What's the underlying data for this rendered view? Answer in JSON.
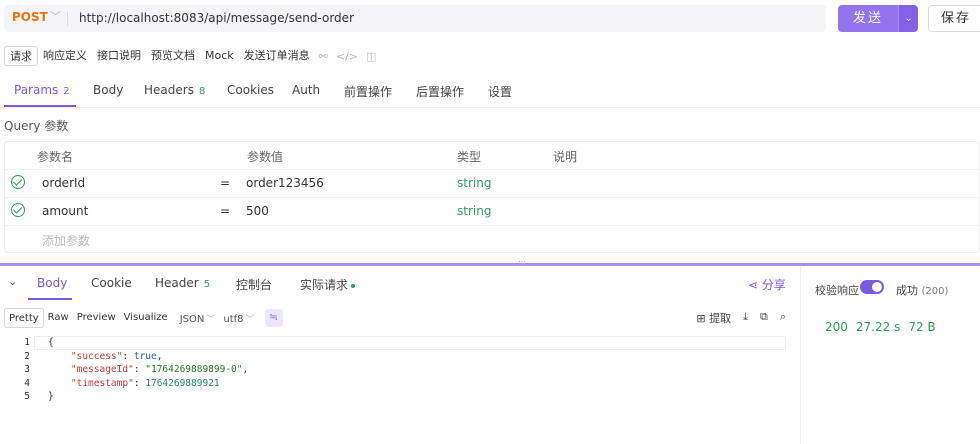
{
  "request": {
    "method": "POST",
    "url": "http://localhost:8083/api/message/send-order",
    "send_label": "发送",
    "save_label": "保存"
  },
  "doc_tabs": [
    "请求",
    "响应定义",
    "接口说明",
    "预览文档",
    "Mock",
    "发送订单消息"
  ],
  "request_tabs": [
    {
      "label": "Params",
      "count": "2"
    },
    {
      "label": "Body",
      "count": ""
    },
    {
      "label": "Headers",
      "count": "8"
    },
    {
      "label": "Cookies",
      "count": ""
    },
    {
      "label": "Auth",
      "count": ""
    },
    {
      "label": "前置操作",
      "count": ""
    },
    {
      "label": "后置操作",
      "count": ""
    },
    {
      "label": "设置",
      "count": ""
    }
  ],
  "query_section_label": "Query 参数",
  "params_table": {
    "headers": [
      "参数名",
      "参数值",
      "类型",
      "说明"
    ],
    "rows": [
      {
        "name": "orderId",
        "eq": "=",
        "value": "order123456",
        "type": "string",
        "desc": ""
      },
      {
        "name": "amount",
        "eq": "=",
        "value": "500",
        "type": "string",
        "desc": ""
      }
    ],
    "add_placeholder": "添加参数"
  },
  "response_tabs": [
    {
      "label": "Body",
      "count": ""
    },
    {
      "label": "Cookie",
      "count": ""
    },
    {
      "label": "Header",
      "count": "5"
    },
    {
      "label": "控制台",
      "count": ""
    },
    {
      "label": "实际请求",
      "count": ""
    }
  ],
  "share_label": "分享",
  "format_buttons": [
    "Pretty",
    "Raw",
    "Preview",
    "Visualize"
  ],
  "format_select": "JSON",
  "encoding_select": "utf8",
  "extract_label": "提取",
  "code_lines": [
    {
      "no": "1",
      "text": "{"
    },
    {
      "no": "2",
      "text": "    \"success\": true,"
    },
    {
      "no": "3",
      "text": "    \"messageId\": \"1764269889899-0\","
    },
    {
      "no": "4",
      "text": "    \"timestamp\": 1764269889921"
    },
    {
      "no": "5",
      "text": "}"
    }
  ],
  "right_panel": {
    "verify_label": "校验响应",
    "verify_enabled": true,
    "success_label": "成功",
    "success_code": "(200)",
    "status": "200",
    "time": "27.22 s",
    "size": "72 B"
  },
  "colors": {
    "accent": "#7a5ae0",
    "send_button": "#9373ee",
    "method": "#e8720c",
    "success": "#2ca05a"
  }
}
